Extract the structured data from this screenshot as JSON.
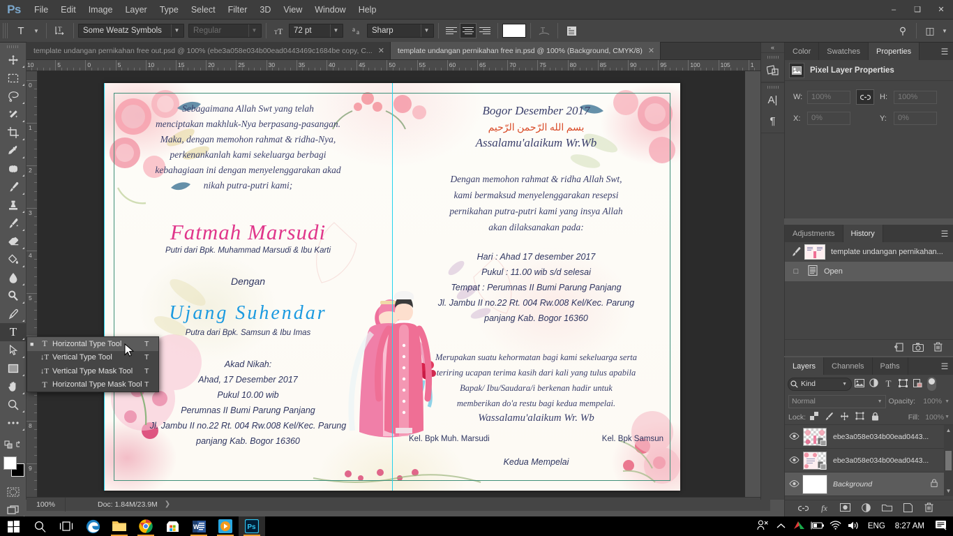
{
  "app": {
    "logo": "Ps"
  },
  "menubar": {
    "items": [
      "File",
      "Edit",
      "Image",
      "Layer",
      "Type",
      "Select",
      "Filter",
      "3D",
      "View",
      "Window",
      "Help"
    ],
    "window_controls": {
      "minimize": "–",
      "maximize": "❑",
      "close": "✕"
    }
  },
  "options_bar": {
    "tool_icon": "T",
    "orientation_icon": "text-orientation",
    "font_family": "Some Weatz Symbols",
    "font_style": "Regular",
    "font_size": "72 pt",
    "anti_alias_icon": "aa",
    "anti_alias": "Sharp",
    "align": {
      "left": "align-left",
      "center": "align-center",
      "right": "align-right",
      "active": "center"
    },
    "color_swatch": "#ffffff",
    "warp_icon": "create-warped-text",
    "panel_icon": "toggle-character-paragraph-panels"
  },
  "tabs": [
    {
      "title": "template undangan pernikahan free out.psd @ 100% (ebe3a058e034b00ead0443469c1684be copy, C...",
      "active": false,
      "close": "✕"
    },
    {
      "title": "template undangan pernikahan free in.psd @ 100%  (Background, CMYK/8)",
      "active": true,
      "close": "✕"
    }
  ],
  "toolbar": {
    "tools": [
      {
        "name": "move-tool",
        "glyph": "✥",
        "selected": false
      },
      {
        "name": "rectangular-marquee-tool",
        "glyph": "⬚",
        "selected": false
      },
      {
        "name": "lasso-tool",
        "glyph": "⟋",
        "selected": false
      },
      {
        "name": "magic-wand-tool",
        "glyph": "✦",
        "selected": false
      },
      {
        "name": "crop-tool",
        "glyph": "⌐",
        "selected": false
      },
      {
        "name": "eyedropper-tool",
        "glyph": "✒",
        "selected": false
      },
      {
        "name": "spot-healing-brush-tool",
        "glyph": "⬚",
        "selected": false
      },
      {
        "name": "brush-tool",
        "glyph": "╱",
        "selected": false
      },
      {
        "name": "clone-stamp-tool",
        "glyph": "⚓",
        "selected": false
      },
      {
        "name": "history-brush-tool",
        "glyph": "✒",
        "selected": false
      },
      {
        "name": "eraser-tool",
        "glyph": "▱",
        "selected": false
      },
      {
        "name": "paint-bucket-tool",
        "glyph": "◇",
        "selected": false
      },
      {
        "name": "blur-tool",
        "glyph": "●",
        "selected": false
      },
      {
        "name": "dodge-tool",
        "glyph": "⚲",
        "selected": false
      },
      {
        "name": "pen-tool",
        "glyph": "✐",
        "selected": false
      },
      {
        "name": "horizontal-type-tool",
        "glyph": "T",
        "selected": true
      },
      {
        "name": "path-selection-tool",
        "glyph": "➤",
        "selected": false
      },
      {
        "name": "rectangle-tool",
        "glyph": "▭",
        "selected": false
      },
      {
        "name": "hand-tool",
        "glyph": "✋",
        "selected": false
      },
      {
        "name": "zoom-tool",
        "glyph": "⚲",
        "selected": false
      },
      {
        "name": "edit-toolbar-tool",
        "glyph": "⋯",
        "selected": false
      }
    ],
    "quick_mask": "quick-mask-mode",
    "screen_mode": "change-screen-mode",
    "foreground_color": "#ffffff",
    "background_color": "#000000"
  },
  "type_flyout": {
    "items": [
      {
        "label": "Horizontal Type Tool",
        "key": "T",
        "icon": "T",
        "selected": true
      },
      {
        "label": "Vertical Type Tool",
        "key": "T",
        "icon": "↓T",
        "selected": false
      },
      {
        "label": "Vertical Type Mask Tool",
        "key": "T",
        "icon": "↓T",
        "selected": false
      },
      {
        "label": "Horizontal Type Mask Tool",
        "key": "T",
        "icon": "T",
        "selected": false
      }
    ]
  },
  "ruler": {
    "h_labels": [
      "10",
      "5",
      "0",
      "5",
      "10",
      "15",
      "20",
      "25",
      "30",
      "35",
      "40",
      "45",
      "50",
      "55",
      "60",
      "65",
      "70",
      "75",
      "80",
      "85",
      "90",
      "95",
      "100",
      "105",
      "1"
    ],
    "v_labels": [
      "0",
      "1",
      "2",
      "3",
      "4",
      "5",
      "6",
      "7",
      "8",
      "9",
      "1"
    ]
  },
  "document": {
    "left_page": {
      "opening": [
        "Sebagaimana Allah Swt yang telah",
        "menciptakan makhluk-Nya berpasang-pasangan.",
        "Maka, dengan memohon rahmat & ridha-Nya,",
        "perkenankanlah kami sekeluarga berbagi",
        "kebahagiaan ini dengan menyelenggarakan akad",
        "nikah putra-putri kami;"
      ],
      "bride_name": "Fatmah   Marsudi",
      "bride_parents": "Putri dari Bpk. Muhammad Marsudi & Ibu Karti",
      "conjunction": "Dengan",
      "groom_name": "Ujang   Suhendar",
      "groom_parents": "Putra dari Bpk. Samsun & Ibu Imas",
      "akad": [
        "Akad Nikah:",
        "Ahad, 17 Desember 2017",
        "Pukul 10.00 wib",
        "Perumnas II Bumi Parung Panjang",
        "Jl. Jambu II no.22 Rt. 004  Rw.008 Kel/Kec. Parung",
        "panjang Kab. Bogor 16360"
      ]
    },
    "right_page": {
      "place_date": "Bogor Desember 2017",
      "basmalah": "بسم الله الرّحمن الرّحيم",
      "greeting": "Assalamu'alaikum Wr.Wb",
      "intro": [
        "Dengan memohon rahmat & ridha Allah Swt,",
        "kami bermaksud menyelenggarakan resepsi",
        "pernikahan putra-putri kami yang insya Allah",
        "akan dilaksanakan pada:"
      ],
      "details": [
        "Hari : Ahad 17 desember 2017",
        "Pukul : 11.00 wib s/d selesai",
        "Tempat : Perumnas II Bumi Parung Panjang",
        "Jl. Jambu II no.22 Rt. 004  Rw.008 Kel/Kec. Parung",
        "panjang Kab. Bogor 16360"
      ],
      "closing": [
        "Merupakan suatu kehormatan bagi kami sekeluarga serta",
        "teriring ucapan terima kasih dari kali yang tulus apabila",
        "Bapak/ Ibu/Saudara/i berkenan hadir untuk",
        "memberikan do'a restu bagi kedua mempelai."
      ],
      "salam": "Wassalamu'alaikum Wr. Wb",
      "family_left": "Kel. Bpk Muh. Marsudi",
      "family_right": "Kel. Bpk Samsun",
      "signature": "Kedua Mempelai"
    }
  },
  "status_bar": {
    "zoom": "100%",
    "doc_size": "Doc: 1.84M/23.9M",
    "arrow": "❯"
  },
  "dock_rail": {
    "collapse": "«",
    "icons": [
      {
        "name": "libraries-icon",
        "glyph": "◧"
      },
      {
        "name": "character-panel-icon",
        "glyph": "A"
      },
      {
        "name": "paragraph-panel-icon",
        "glyph": "¶"
      }
    ]
  },
  "properties_panel": {
    "tabs": [
      {
        "label": "Color",
        "active": false
      },
      {
        "label": "Swatches",
        "active": false
      },
      {
        "label": "Properties",
        "active": true
      }
    ],
    "menu_icon": "☰",
    "title": "Pixel Layer Properties",
    "thumb_icon": "pixel-layer-icon",
    "fields": [
      {
        "label": "W:",
        "value": "100%"
      },
      {
        "label": "H:",
        "value": "100%"
      },
      {
        "label": "X:",
        "value": "0%"
      },
      {
        "label": "Y:",
        "value": "0%"
      }
    ],
    "link_icon": "∞"
  },
  "history_panel": {
    "tabs": [
      {
        "label": "Adjustments",
        "active": false
      },
      {
        "label": "History",
        "active": true
      }
    ],
    "menu_icon": "☰",
    "snapshot": "template undangan pernikahan...",
    "states": [
      {
        "label": "Open",
        "selected": true
      }
    ],
    "footer_icons": [
      {
        "name": "new-document-from-state-icon",
        "glyph": "❐"
      },
      {
        "name": "new-snapshot-icon",
        "glyph": "▣"
      },
      {
        "name": "delete-icon",
        "glyph": "Ὕ1"
      }
    ]
  },
  "layers_panel": {
    "tabs": [
      {
        "label": "Layers",
        "active": true
      },
      {
        "label": "Channels",
        "active": false
      },
      {
        "label": "Paths",
        "active": false
      }
    ],
    "menu_icon": "☰",
    "filter": {
      "kind_label": "Kind",
      "search_icon": "search-icon",
      "icons": [
        {
          "name": "filter-pixel-icon",
          "glyph": "▣"
        },
        {
          "name": "filter-adjustment-icon",
          "glyph": "◑"
        },
        {
          "name": "filter-type-icon",
          "glyph": "T"
        },
        {
          "name": "filter-shape-icon",
          "glyph": "⬚"
        },
        {
          "name": "filter-smart-object-icon",
          "glyph": "◰"
        }
      ],
      "toggle": "filter-enable-toggle"
    },
    "blend_mode": "Normal",
    "opacity_label": "Opacity:",
    "opacity_value": "100%",
    "lock_label": "Lock:",
    "lock_icons": [
      {
        "name": "lock-transparent-pixels-icon",
        "glyph": "▦"
      },
      {
        "name": "lock-image-pixels-icon",
        "glyph": "╱"
      },
      {
        "name": "lock-position-icon",
        "glyph": "✥"
      },
      {
        "name": "lock-artboard-nesting-icon",
        "glyph": "⬚"
      },
      {
        "name": "lock-all-icon",
        "glyph": "🔒"
      }
    ],
    "fill_label": "Fill:",
    "fill_value": "100%",
    "layers": [
      {
        "name": "ebe3a058e034b00ead0443...",
        "visible": true,
        "kind": "smart-object",
        "selected": false,
        "locked": false,
        "italic": false
      },
      {
        "name": "ebe3a058e034b00ead0443...",
        "visible": true,
        "kind": "smart-object",
        "selected": false,
        "locked": false,
        "italic": false
      },
      {
        "name": "Background",
        "visible": true,
        "kind": "background",
        "selected": true,
        "locked": true,
        "italic": true
      }
    ],
    "footer_icons": [
      {
        "name": "link-layers-icon",
        "glyph": "∞"
      },
      {
        "name": "layer-style-icon",
        "glyph": "fx"
      },
      {
        "name": "layer-mask-icon",
        "glyph": "▣"
      },
      {
        "name": "adjustment-layer-icon",
        "glyph": "◑"
      },
      {
        "name": "new-group-icon",
        "glyph": "❐"
      },
      {
        "name": "new-layer-icon",
        "glyph": "⬚"
      },
      {
        "name": "delete-layer-icon",
        "glyph": "🗑"
      }
    ]
  },
  "taskbar": {
    "items": [
      {
        "name": "start-button",
        "glyph": "⊞"
      },
      {
        "name": "search-icon",
        "glyph": "⚲"
      },
      {
        "name": "task-view-icon",
        "glyph": "❐"
      },
      {
        "name": "edge-icon",
        "glyph": "e"
      },
      {
        "name": "file-explorer-icon",
        "glyph": "📁"
      },
      {
        "name": "chrome-icon",
        "glyph": "◉"
      },
      {
        "name": "microsoft-store-icon",
        "glyph": "⊞"
      },
      {
        "name": "word-icon",
        "glyph": "W"
      },
      {
        "name": "media-player-icon",
        "glyph": "▶"
      },
      {
        "name": "photoshop-icon",
        "glyph": "Ps"
      }
    ],
    "tray": {
      "icons": [
        {
          "name": "people-icon",
          "glyph": "⚯"
        },
        {
          "name": "show-hidden-icons-icon",
          "glyph": "∧"
        },
        {
          "name": "graphics-driver-icon",
          "glyph": "▲"
        },
        {
          "name": "battery-icon",
          "glyph": "▭"
        },
        {
          "name": "wifi-icon",
          "glyph": "◠"
        },
        {
          "name": "volume-icon",
          "glyph": "🔊"
        }
      ],
      "language": "ENG",
      "clock": "8:27 AM",
      "action_center": "notification-icon"
    }
  }
}
